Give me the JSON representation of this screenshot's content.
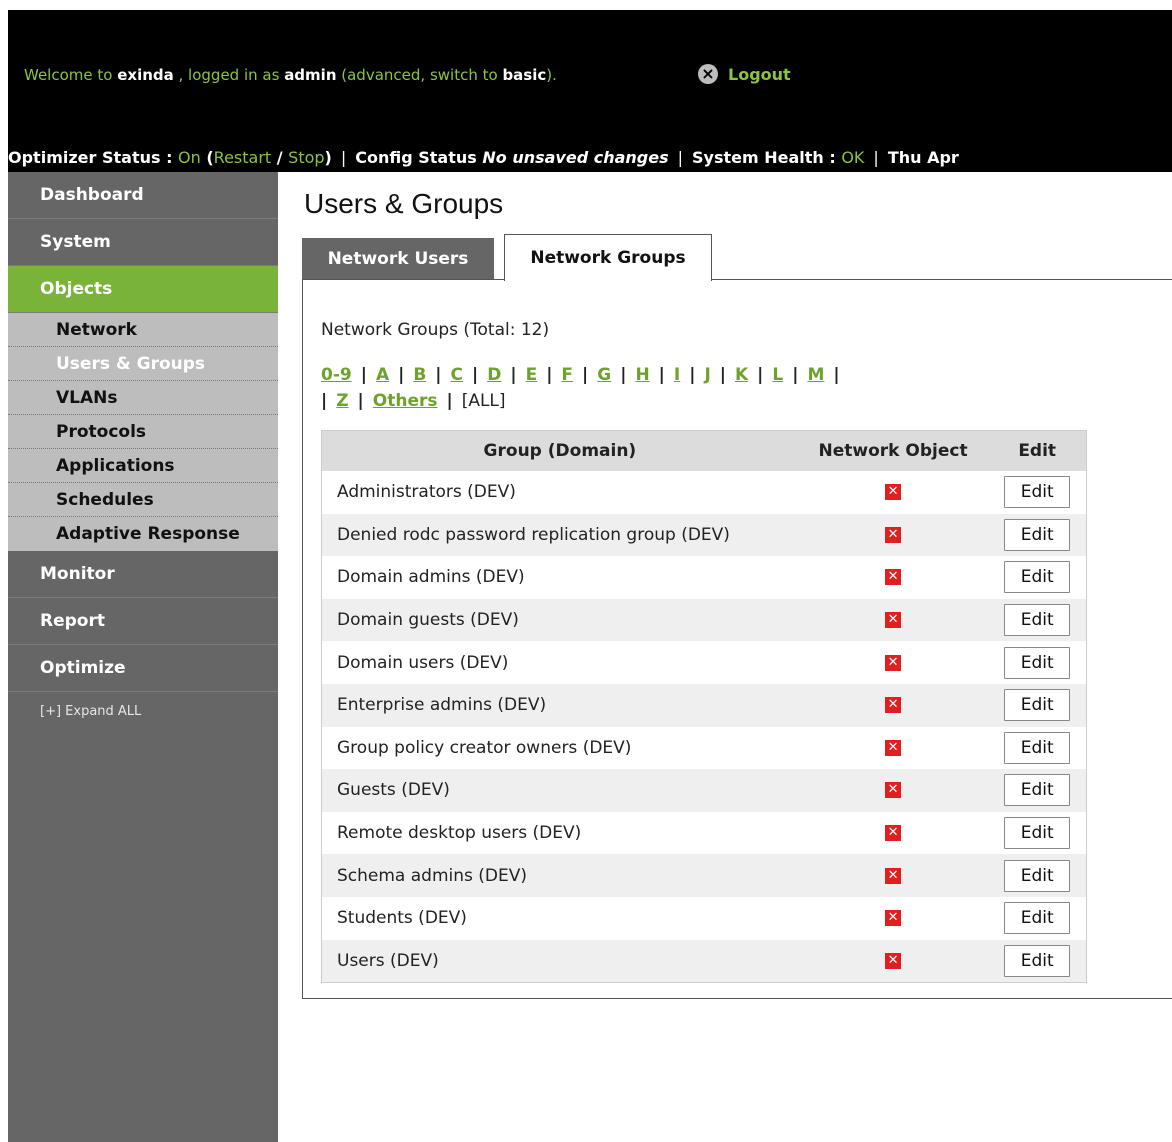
{
  "header": {
    "welcome_prefix": "Welcome to ",
    "app_name": "exinda",
    "logged_in_text": " , logged in as ",
    "user": "admin",
    "mode_prefix": " (advanced, switch to ",
    "mode_link": "basic",
    "mode_suffix": ").",
    "logout_label": "Logout"
  },
  "statusbar": {
    "optimizer_label": "Optimizer Status : ",
    "optimizer_value": "On",
    "optimizer_open": " (",
    "restart": "Restart",
    "slash": " / ",
    "stop": "Stop",
    "optimizer_close": ")",
    "sep": "|",
    "config_label": "Config Status ",
    "config_value": "No unsaved changes",
    "health_label": "System Health : ",
    "health_value": "OK",
    "date": "Thu Apr"
  },
  "sidebar": {
    "items": [
      {
        "label": "Dashboard"
      },
      {
        "label": "System"
      },
      {
        "label": "Objects"
      },
      {
        "label": "Monitor"
      },
      {
        "label": "Report"
      },
      {
        "label": "Optimize"
      }
    ],
    "subitems": [
      {
        "label": "Network"
      },
      {
        "label": "Users & Groups"
      },
      {
        "label": "VLANs"
      },
      {
        "label": "Protocols"
      },
      {
        "label": "Applications"
      },
      {
        "label": "Schedules"
      },
      {
        "label": "Adaptive Response"
      }
    ],
    "expand_all": "[+] Expand ALL"
  },
  "page": {
    "title": "Users & Groups",
    "tabs": [
      {
        "label": "Network Users"
      },
      {
        "label": "Network Groups"
      }
    ],
    "total_label": "Network Groups (Total: 12)"
  },
  "alphabet": {
    "letters": [
      "0-9",
      "A",
      "B",
      "C",
      "D",
      "E",
      "F",
      "G",
      "H",
      "I",
      "J",
      "K",
      "L",
      "M"
    ],
    "z": "Z",
    "others": "Others",
    "all": "[ALL]"
  },
  "table": {
    "headers": [
      "Group (Domain)",
      "Network Object",
      "Edit"
    ],
    "edit_label": "Edit",
    "rows": [
      "Administrators (DEV)",
      "Denied rodc password replication group (DEV)",
      "Domain admins (DEV)",
      "Domain guests (DEV)",
      "Domain users (DEV)",
      "Enterprise admins (DEV)",
      "Group policy creator owners (DEV)",
      "Guests (DEV)",
      "Remote desktop users (DEV)",
      "Schema admins (DEV)",
      "Students (DEV)",
      "Users (DEV)"
    ]
  },
  "colors": {
    "accent_green": "#8bc53f",
    "link_green": "#6da32d",
    "active_nav": "#7ab33a",
    "sidebar_bg": "#666666",
    "error_red": "#e02020"
  }
}
